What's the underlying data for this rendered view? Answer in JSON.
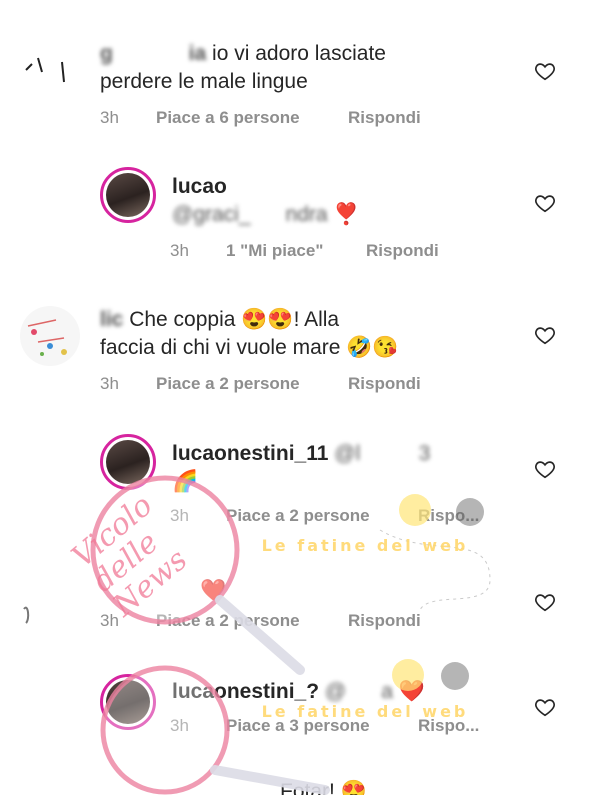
{
  "comments": [
    {
      "username": "g             ia",
      "text_line1": "io vi adoro lasciate",
      "text_line2": "perdere le male lingue",
      "time": "3h",
      "likes": "Piace a 6 persone",
      "reply": "Rispondi"
    },
    {
      "username": "lucao",
      "mention": "@graci_      ndra",
      "emoji": "❣️",
      "time": "3h",
      "likes": "1 \"Mi piace\"",
      "reply": "Rispondi"
    },
    {
      "username": "lic",
      "text_line1": "Che coppia 😍😍! Alla",
      "text_line2": "faccia di chi vi vuole mare 🤣😘",
      "time": "3h",
      "likes": "Piace a 2 persone",
      "reply": "Rispondi"
    },
    {
      "username": "lucaonestini_11",
      "mention": "@l          3",
      "emoji": "🌈",
      "time": "3h",
      "likes": "Piace a 2 persone",
      "reply": "Rispo..."
    },
    {
      "username": "",
      "emoji": "❤️",
      "time": "3h",
      "likes": "Piace a 2 persone",
      "reply": "Rispondi"
    },
    {
      "username": "lucaonestini_?",
      "mention": "@      a",
      "emoji": "❤️",
      "time": "3h",
      "likes": "Piace a 3 persone",
      "reply": "Rispo..."
    },
    {
      "username": "",
      "text_line1": "Fotar! 😍",
      "time": "",
      "likes": "",
      "reply": ""
    }
  ],
  "watermark": {
    "brand": "Vicolo delle News",
    "tagline": "Le fatine del web"
  },
  "colors": {
    "meta": "#8e8e8e",
    "story_ring": "#d6249f",
    "watermark_pink": "#f07896"
  },
  "icons": {
    "like": "heart-outline-icon"
  }
}
